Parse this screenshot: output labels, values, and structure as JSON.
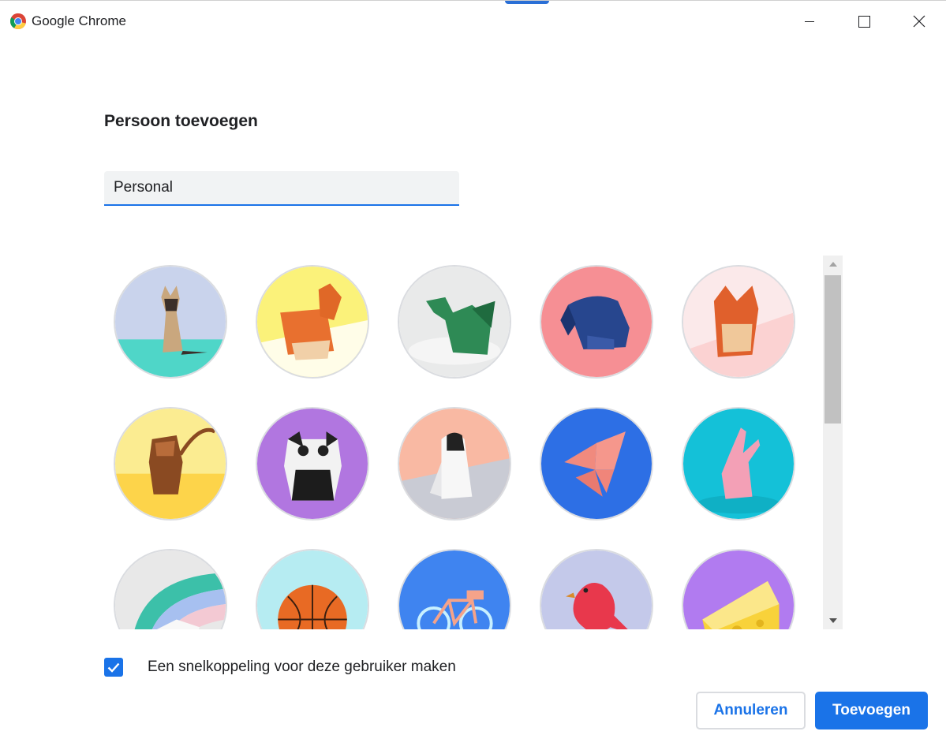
{
  "window": {
    "title": "Google Chrome",
    "controls": {
      "minimize": "minimize-icon",
      "maximize": "maximize-icon",
      "close": "close-icon"
    }
  },
  "dialog": {
    "title": "Persoon toevoegen",
    "name_input": {
      "value": "Personal",
      "placeholder": ""
    }
  },
  "avatars": [
    {
      "name": "cat",
      "bg": "#c9d3ec"
    },
    {
      "name": "corgi",
      "bg": "#fbf27a"
    },
    {
      "name": "dragon",
      "bg": "#e9eaea"
    },
    {
      "name": "elephant",
      "bg": "#f68f94"
    },
    {
      "name": "fox",
      "bg": "#fbd2d2"
    },
    {
      "name": "monkey",
      "bg": "#fbec91"
    },
    {
      "name": "panda",
      "bg": "#b176e0"
    },
    {
      "name": "penguin",
      "bg": "#f9b9a3"
    },
    {
      "name": "butterfly",
      "bg": "#2d6fe5"
    },
    {
      "name": "rabbit",
      "bg": "#14c1d8"
    },
    {
      "name": "unicorn",
      "bg": "#e8e8e8"
    },
    {
      "name": "basketball",
      "bg": "#b6ecf2"
    },
    {
      "name": "bike",
      "bg": "#3f84f0"
    },
    {
      "name": "bird",
      "bg": "#c4c9ea"
    },
    {
      "name": "cheese",
      "bg": "#b17bf0"
    }
  ],
  "shortcut": {
    "checked": true,
    "label": "Een snelkoppeling voor deze gebruiker maken"
  },
  "buttons": {
    "cancel": "Annuleren",
    "add": "Toevoegen"
  },
  "colors": {
    "accent": "#1a73e8",
    "border": "#dadce0",
    "input_bg": "#f1f3f4"
  }
}
